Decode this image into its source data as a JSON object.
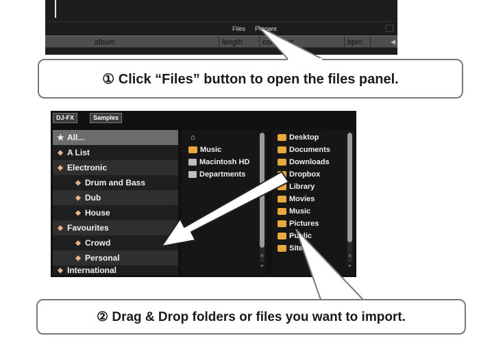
{
  "top": {
    "files_label": "Files",
    "prepare_label": "Prepare",
    "columns": [
      "album",
      "length",
      "comment",
      "bpm"
    ]
  },
  "callouts": {
    "step1": "① Click “Files” button to open the files panel.",
    "step2": "② Drag & Drop folders or files you want to import."
  },
  "browser": {
    "tabs": [
      "DJ-FX",
      "Samples"
    ],
    "crates": [
      {
        "label": "All...",
        "icon": "star-icon",
        "indent": 0,
        "selected": true
      },
      {
        "label": "A List",
        "icon": "crate-icon",
        "indent": 0
      },
      {
        "label": "Electronic",
        "icon": "crate-icon",
        "indent": 0
      },
      {
        "label": "Drum and Bass",
        "icon": "crate-icon",
        "indent": 1
      },
      {
        "label": "Dub",
        "icon": "crate-icon",
        "indent": 1
      },
      {
        "label": "House",
        "icon": "crate-icon",
        "indent": 1
      },
      {
        "label": "Favourites",
        "icon": "crate-icon",
        "indent": 0
      },
      {
        "label": "Crowd",
        "icon": "crate-icon",
        "indent": 1
      },
      {
        "label": "Personal",
        "icon": "crate-icon",
        "indent": 1
      },
      {
        "label": "International",
        "icon": "crate-icon",
        "indent": 0
      }
    ],
    "locations": [
      {
        "label": "",
        "icon": "home-icon"
      },
      {
        "label": "Music",
        "icon": "folder-icon"
      },
      {
        "label": "Macintosh HD",
        "icon": "drive-icon"
      },
      {
        "label": "Departments",
        "icon": "drive-icon"
      }
    ],
    "folders": [
      "Desktop",
      "Documents",
      "Downloads",
      "Dropbox",
      "Library",
      "Movies",
      "Music",
      "Pictures",
      "Public",
      "Sites"
    ]
  },
  "colors": {
    "folder": "#e8a93a",
    "crate": "#e8b48c",
    "callout_border": "#777777"
  }
}
